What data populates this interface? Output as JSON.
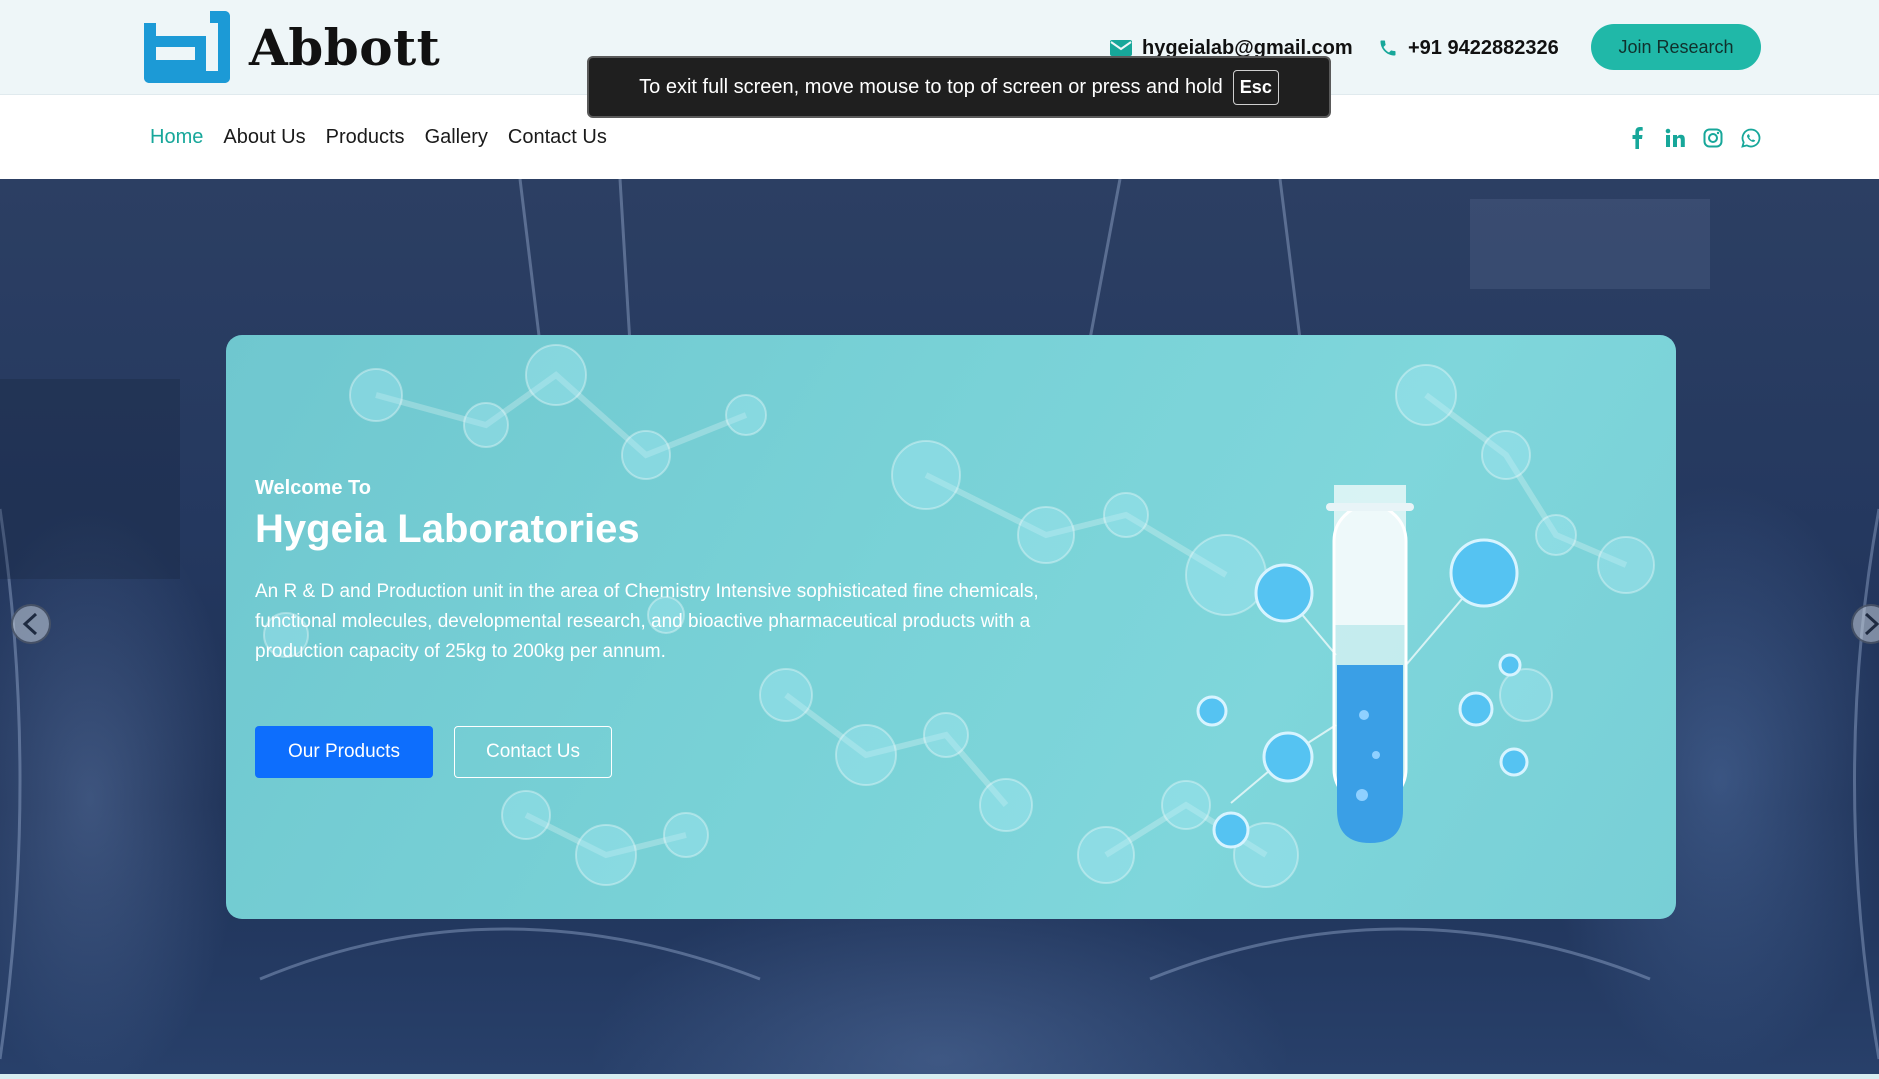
{
  "brand": {
    "name": "Abbott",
    "logo_icon": "abbott-logo-icon",
    "accent": "#20b8a8",
    "logo_blue": "#1c9ad6"
  },
  "topbar": {
    "email": "hygeialab@gmail.com",
    "phone": "+91 9422882326",
    "join_label": "Join Research"
  },
  "nav": {
    "items": [
      {
        "label": "Home",
        "active": true
      },
      {
        "label": "About Us",
        "active": false
      },
      {
        "label": "Products",
        "active": false
      },
      {
        "label": "Gallery",
        "active": false
      },
      {
        "label": "Contact Us",
        "active": false
      }
    ],
    "socials": [
      "facebook-icon",
      "linkedin-icon",
      "instagram-icon",
      "whatsapp-icon"
    ]
  },
  "hero": {
    "welcome": "Welcome To",
    "title": "Hygeia Laboratories",
    "description": "An R & D and Production unit in the area of Chemistry Intensive sophisticated fine chemicals, functional molecules, developmental research, and bioactive pharmaceutical products with a production capacity of 25kg to 200kg per annum.",
    "primary_button": "Our Products",
    "secondary_button": "Contact Us",
    "primary_color": "#0d6efd"
  },
  "fullscreen_notice": {
    "text": "To exit full screen, move mouse to top of screen or press and hold",
    "key": "Esc"
  }
}
